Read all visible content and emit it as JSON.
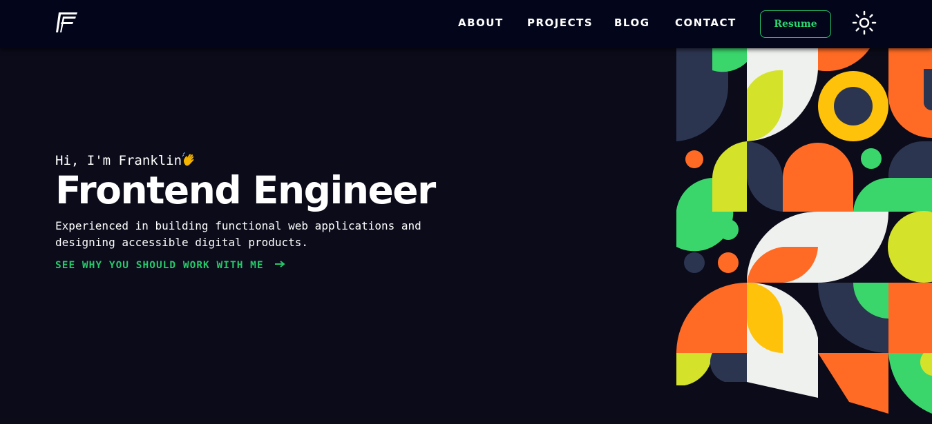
{
  "nav": {
    "logo_icon": "ff-logo-icon",
    "links": [
      {
        "label": "ABOUT"
      },
      {
        "label": "PROJECTS"
      },
      {
        "label": "BLOG"
      },
      {
        "label": "CONTACT"
      }
    ],
    "resume_label": "Resume",
    "theme_toggle_icon": "sun-icon"
  },
  "hero": {
    "greeting": "Hi, I'm Franklin",
    "greeting_icon": "waving-hand-icon",
    "headline": "Frontend Engineer",
    "tagline": "Experienced in building functional web applications and designing accessible digital products.",
    "cta_label": "SEE WHY YOU SHOULD WORK WITH ME",
    "cta_icon": "arrow-right-icon"
  },
  "colors": {
    "background": "#0b0b1a",
    "nav_background": "#03051a",
    "accent": "#27c86a",
    "pattern_orange": "#ff6b24",
    "pattern_green": "#3ad66b",
    "pattern_lime": "#d4e22a",
    "pattern_yellow": "#ffc20a",
    "pattern_navy": "#2c3550",
    "pattern_white": "#eff1ee"
  }
}
